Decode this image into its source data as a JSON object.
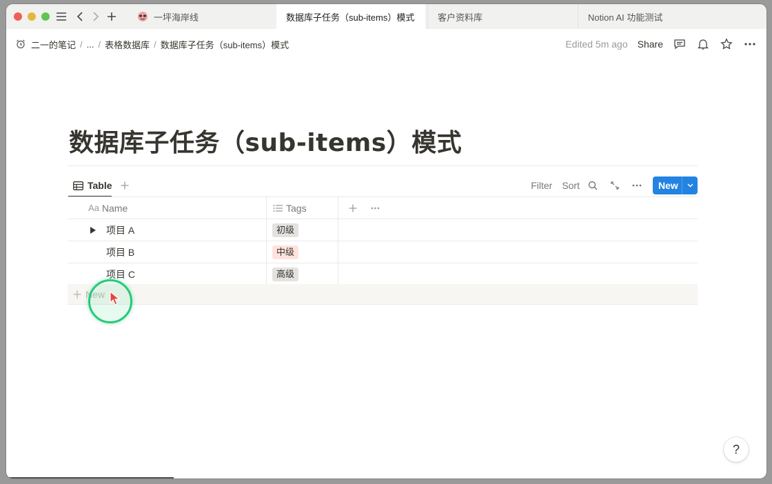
{
  "tabs": [
    {
      "label": "一坪海岸线",
      "active": false
    },
    {
      "label": "数据库子任务（sub-items）模式",
      "active": true
    },
    {
      "label": "客户资料库",
      "active": false
    },
    {
      "label": "Notion AI 功能测试",
      "active": false
    }
  ],
  "breadcrumb": {
    "items": [
      "二一的笔记",
      "...",
      "表格数据库",
      "数据库子任务（sub-items）模式"
    ]
  },
  "topbar": {
    "edited": "Edited 5m ago",
    "share": "Share"
  },
  "page": {
    "title": "数据库子任务（sub-items）模式"
  },
  "view": {
    "tab_label": "Table",
    "filter": "Filter",
    "sort": "Sort",
    "new_label": "New"
  },
  "table": {
    "name_icon_text": "Aa",
    "columns": [
      "Name",
      "Tags"
    ],
    "rows": [
      {
        "name": "项目 A",
        "tag": "初级",
        "tag_color": "#e3e2e0",
        "has_toggle": true
      },
      {
        "name": "项目 B",
        "tag": "中级",
        "tag_color": "#ffe2dd",
        "has_toggle": false
      },
      {
        "name": "项目 C",
        "tag": "高级",
        "tag_color": "#e3e2e0",
        "has_toggle": false
      }
    ],
    "new_row": "New"
  },
  "help": "?",
  "colors": {
    "accent": "#2383e2",
    "cursor_ring": "#26c97a"
  }
}
